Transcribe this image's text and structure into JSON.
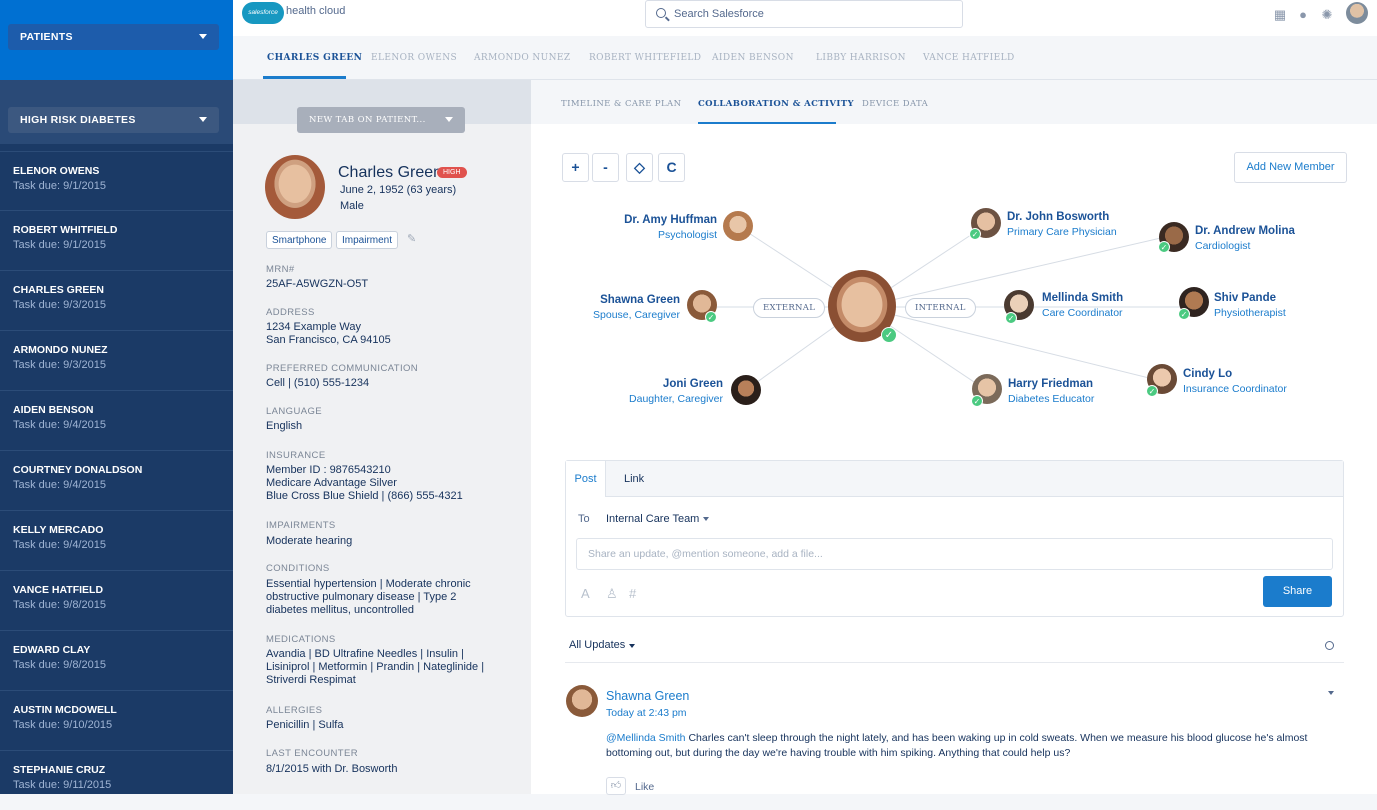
{
  "sidebar": {
    "list_select": "PATIENTS",
    "cohort_select": "HIGH RISK DIABETES",
    "patients": [
      {
        "name": "ELENOR OWENS",
        "due": "Task due: 9/1/2015"
      },
      {
        "name": "ROBERT WHITFIELD",
        "due": "Task due: 9/1/2015"
      },
      {
        "name": "CHARLES GREEN",
        "due": "Task due: 9/3/2015"
      },
      {
        "name": "ARMONDO NUNEZ",
        "due": "Task due: 9/3/2015"
      },
      {
        "name": "AIDEN BENSON",
        "due": "Task due: 9/4/2015"
      },
      {
        "name": "COURTNEY DONALDSON",
        "due": "Task due: 9/4/2015"
      },
      {
        "name": "KELLY MERCADO",
        "due": "Task due: 9/4/2015"
      },
      {
        "name": "VANCE HATFIELD",
        "due": "Task due: 9/8/2015"
      },
      {
        "name": "EDWARD CLAY",
        "due": "Task due: 9/8/2015"
      },
      {
        "name": "AUSTIN MCDOWELL",
        "due": "Task due: 9/10/2015"
      },
      {
        "name": "STEPHANIE CRUZ",
        "due": "Task due: 9/11/2015"
      }
    ]
  },
  "header": {
    "logo": "salesforce",
    "product": "health cloud",
    "search_placeholder": "Search Salesforce",
    "icons": [
      "grid-icon",
      "help-icon",
      "gear-icon",
      "user-avatar"
    ]
  },
  "patient_tabs": [
    "CHARLES GREEN",
    "ELENOR OWENS",
    "ARMONDO NUNEZ",
    "ROBERT WHITEFIELD",
    "AIDEN BENSON",
    "LIBBY HARRISON",
    "VANCE HATFIELD"
  ],
  "detail": {
    "new_tab_button": "NEW TAB ON PATIENT...",
    "name": "Charles Green",
    "risk_badge": "HIGH",
    "dob": "June 2, 1952 (63 years)",
    "sex": "Male",
    "chips": [
      "Smartphone",
      "Impairment"
    ],
    "fields": {
      "mrn_label": "MRN#",
      "mrn": "25AF-A5WGZN-O5T",
      "address_label": "ADDRESS",
      "address_1": "1234 Example Way",
      "address_2": "San Francisco, CA 94105",
      "comm_label": "PREFERRED COMMUNICATION",
      "comm": "Cell | (510) 555-1234",
      "language_label": "LANGUAGE",
      "language": "English",
      "insurance_label": "INSURANCE",
      "insurance_1": "Member ID : 9876543210",
      "insurance_2": "Medicare Advantage Silver",
      "insurance_3": "Blue Cross Blue Shield | (866) 555-4321",
      "impairments_label": "IMPAIRMENTS",
      "impairments": "Moderate hearing",
      "conditions_label": "CONDITIONS",
      "conditions": "Essential hypertension | Moderate chronic obstructive pulmonary disease | Type 2 diabetes mellitus, uncontrolled",
      "medications_label": "MEDICATIONS",
      "medications": "Avandia | BD Ultrafine Needles | Insulin | Lisiniprol | Metformin | Prandin | Nateglinide | Striverdi Respimat",
      "allergies_label": "ALLERGIES",
      "allergies": "Penicillin | Sulfa",
      "last_encounter_label": "LAST ENCOUNTER",
      "last_encounter": "8/1/2015 with Dr. Bosworth"
    }
  },
  "main": {
    "subtabs": [
      "TIMELINE & CARE PLAN",
      "COLLABORATION & ACTIVITY",
      "DEVICE DATA"
    ],
    "zoom_controls": [
      "+",
      "-",
      "◇",
      "C"
    ],
    "add_member_button": "Add New Member",
    "groups": {
      "external": "EXTERNAL",
      "internal": "INTERNAL"
    },
    "external_members": [
      {
        "name": "Dr. Amy Huffman",
        "role": "Psychologist"
      },
      {
        "name": "Shawna Green",
        "role": "Spouse, Caregiver"
      },
      {
        "name": "Joni Green",
        "role": "Daughter, Caregiver"
      }
    ],
    "internal_members": [
      {
        "name": "Dr. John Bosworth",
        "role": "Primary Care Physician"
      },
      {
        "name": "Dr. Andrew Molina",
        "role": "Cardiologist"
      },
      {
        "name": "Mellinda Smith",
        "role": "Care Coordinator"
      },
      {
        "name": "Shiv Pande",
        "role": "Physiotherapist"
      },
      {
        "name": "Harry Friedman",
        "role": "Diabetes Educator"
      },
      {
        "name": "Cindy Lo",
        "role": "Insurance Coordinator"
      }
    ],
    "publisher": {
      "tab_post": "Post",
      "tab_link": "Link",
      "to_label": "To",
      "to_value": "Internal Care Team",
      "input_placeholder": "Share an update, @mention someone, add a file...",
      "share_button": "Share"
    },
    "feed": {
      "filter": "All Updates",
      "post": {
        "author": "Shawna Green",
        "time": "Today at 2:43 pm",
        "mention": "@Mellinda Smith",
        "body": " Charles can't sleep through the night lately, and has been waking up in cold sweats. When we measure his blood glucose he's almost bottoming out, but during the day we're having trouble with him spiking.  Anything that could help us?",
        "like_label": "Like"
      }
    }
  },
  "colors": {
    "sidebar": "#1b3a66",
    "sidebar_top": "#0070d2",
    "accent": "#1b7ccc",
    "high_badge": "#e0524d",
    "check": "#4bca81"
  }
}
